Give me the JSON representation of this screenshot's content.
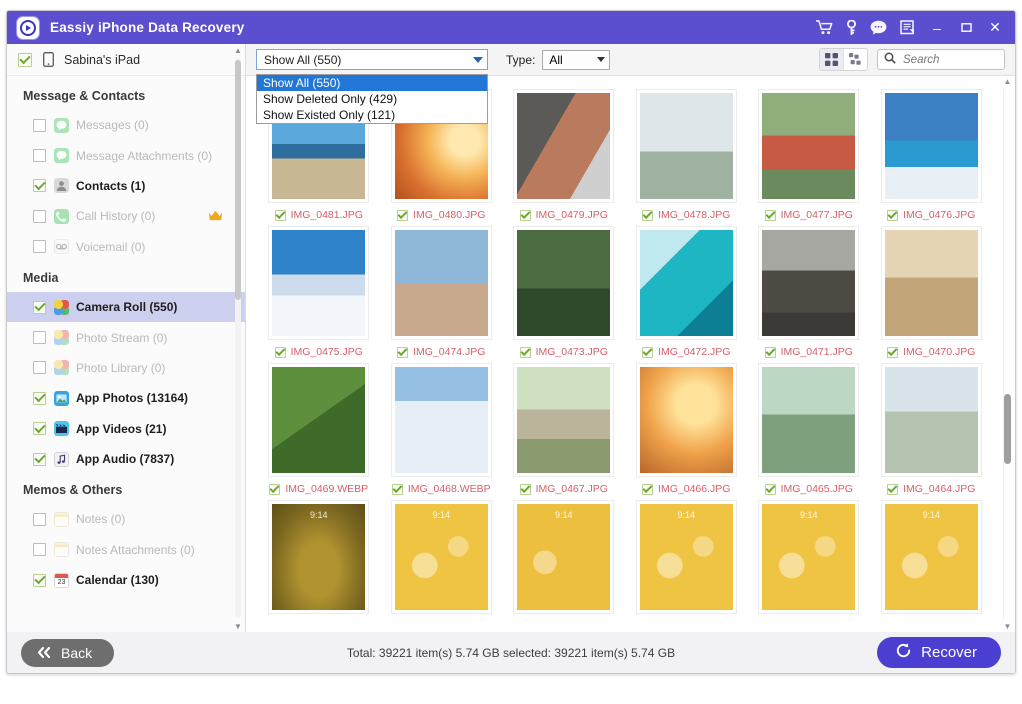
{
  "window": {
    "title": "Eassiy iPhone Data Recovery",
    "logo_icon": "eassiy-logo-icon",
    "accent_color": "#5b4fcf",
    "toolbar_icons": [
      {
        "name": "cart-icon",
        "glyph": "cart"
      },
      {
        "name": "key-icon",
        "glyph": "key"
      },
      {
        "name": "chat-icon",
        "glyph": "chat"
      },
      {
        "name": "register-icon",
        "glyph": "register"
      }
    ],
    "controls": {
      "minimize": "–",
      "maximize": "☐",
      "close": "✕"
    }
  },
  "sidebar": {
    "device": {
      "label": "Sabina's iPad",
      "checked": true,
      "icon": "tablet-icon"
    },
    "groups": [
      {
        "title": "Message & Contacts",
        "items": [
          {
            "label": "Messages (0)",
            "checked": false,
            "enabled": false,
            "icon": "messages-icon",
            "premium": false
          },
          {
            "label": "Message Attachments (0)",
            "checked": false,
            "enabled": false,
            "icon": "message-attachments-icon",
            "premium": false
          },
          {
            "label": "Contacts (1)",
            "checked": true,
            "enabled": true,
            "icon": "contacts-icon",
            "premium": false
          },
          {
            "label": "Call History (0)",
            "checked": false,
            "enabled": false,
            "icon": "call-history-icon",
            "premium": true
          },
          {
            "label": "Voicemail (0)",
            "checked": false,
            "enabled": false,
            "icon": "voicemail-icon",
            "premium": false
          }
        ]
      },
      {
        "title": "Media",
        "items": [
          {
            "label": "Camera Roll (550)",
            "checked": true,
            "enabled": true,
            "icon": "camera-roll-icon",
            "selected": true,
            "premium": false
          },
          {
            "label": "Photo Stream (0)",
            "checked": false,
            "enabled": false,
            "icon": "photo-stream-icon",
            "premium": false
          },
          {
            "label": "Photo Library (0)",
            "checked": false,
            "enabled": false,
            "icon": "photo-library-icon",
            "premium": false
          },
          {
            "label": "App Photos (13164)",
            "checked": true,
            "enabled": true,
            "icon": "app-photos-icon",
            "premium": false
          },
          {
            "label": "App Videos (21)",
            "checked": true,
            "enabled": true,
            "icon": "app-videos-icon",
            "premium": false
          },
          {
            "label": "App Audio (7837)",
            "checked": true,
            "enabled": true,
            "icon": "app-audio-icon",
            "premium": false
          }
        ]
      },
      {
        "title": "Memos & Others",
        "items": [
          {
            "label": "Notes (0)",
            "checked": false,
            "enabled": false,
            "icon": "notes-icon",
            "premium": false
          },
          {
            "label": "Notes Attachments (0)",
            "checked": false,
            "enabled": false,
            "icon": "notes-attachments-icon",
            "premium": false
          },
          {
            "label": "Calendar (130)",
            "checked": true,
            "enabled": true,
            "icon": "calendar-icon",
            "premium": false
          }
        ]
      }
    ]
  },
  "toolbar": {
    "filter_selected": "Show All (550)",
    "filter_options": [
      {
        "label": "Show All (550)",
        "highlighted": true
      },
      {
        "label": "Show Deleted Only (429)",
        "highlighted": false
      },
      {
        "label": "Show Existed Only (121)",
        "highlighted": false
      }
    ],
    "type_label": "Type:",
    "type_selected": "All",
    "view_large_icon": "grid-large-icon",
    "view_small_icon": "grid-small-icon",
    "search": {
      "placeholder": "Search",
      "value": "",
      "icon": "search-icon"
    }
  },
  "grid": {
    "rows": [
      [
        {
          "name": "IMG_0481.JPG",
          "checked": true,
          "art": "sailboats"
        },
        {
          "name": "IMG_0480.JPG",
          "checked": true,
          "art": "runner-sunset"
        },
        {
          "name": "IMG_0479.JPG",
          "checked": true,
          "art": "woman-selfie"
        },
        {
          "name": "IMG_0478.JPG",
          "checked": true,
          "art": "skateboarder"
        },
        {
          "name": "IMG_0477.JPG",
          "checked": true,
          "art": "woman-track"
        },
        {
          "name": "IMG_0476.JPG",
          "checked": true,
          "art": "windsurf"
        }
      ],
      [
        {
          "name": "IMG_0475.JPG",
          "checked": true,
          "art": "snow-mountain"
        },
        {
          "name": "IMG_0474.JPG",
          "checked": true,
          "art": "woman-stretch"
        },
        {
          "name": "IMG_0473.JPG",
          "checked": true,
          "art": "yoga-forest"
        },
        {
          "name": "IMG_0472.JPG",
          "checked": true,
          "art": "surf-wave"
        },
        {
          "name": "IMG_0471.JPG",
          "checked": true,
          "art": "beach-rocks"
        },
        {
          "name": "IMG_0470.JPG",
          "checked": true,
          "art": "sprint-start"
        }
      ],
      [
        {
          "name": "IMG_0469.WEBP",
          "checked": true,
          "art": "zipline"
        },
        {
          "name": "IMG_0468.WEBP",
          "checked": true,
          "art": "skier"
        },
        {
          "name": "IMG_0467.JPG",
          "checked": true,
          "art": "road-runner"
        },
        {
          "name": "IMG_0466.JPG",
          "checked": true,
          "art": "legs-sunset"
        },
        {
          "name": "IMG_0465.JPG",
          "checked": true,
          "art": "yoga-sunset"
        },
        {
          "name": "IMG_0464.JPG",
          "checked": true,
          "art": "drinking-water"
        }
      ],
      [
        {
          "name": "",
          "checked": false,
          "art": "lock-dark"
        },
        {
          "name": "",
          "checked": false,
          "art": "lock-yellow"
        },
        {
          "name": "",
          "checked": false,
          "art": "lock-yellow-scribble"
        },
        {
          "name": "",
          "checked": false,
          "art": "lock-yellow"
        },
        {
          "name": "",
          "checked": false,
          "art": "lock-yellow"
        },
        {
          "name": "",
          "checked": false,
          "art": "lock-yellow"
        }
      ]
    ]
  },
  "footer": {
    "back_label": "Back",
    "back_icon": "chevron-left-double-icon",
    "status": "Total: 39221 item(s) 5.74 GB   selected: 39221 item(s) 5.74 GB",
    "recover_label": "Recover",
    "recover_icon": "recover-circular-arrow-icon",
    "recover_color": "#4a3fd0"
  }
}
